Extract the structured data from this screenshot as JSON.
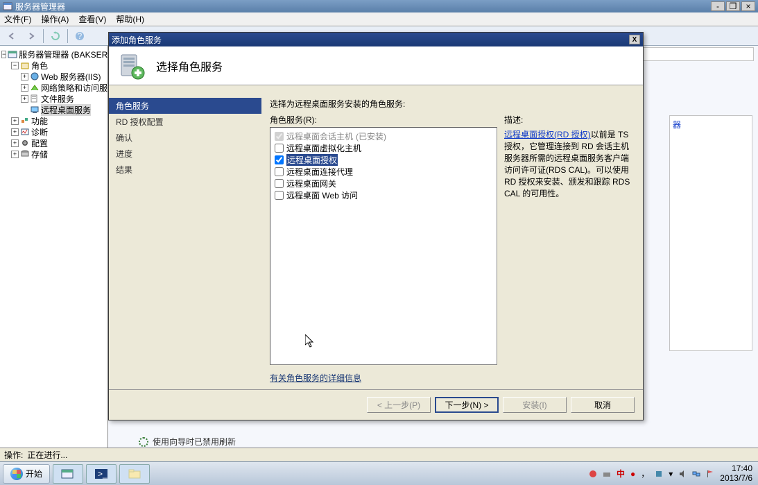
{
  "window": {
    "title": "服务器管理器",
    "minimize": "-",
    "restore": "❐",
    "close": "×"
  },
  "menu": {
    "file": "文件(F)",
    "action": "操作(A)",
    "view": "查看(V)",
    "help": "帮助(H)"
  },
  "tree": {
    "root": "服务器管理器 (BAKSERVEP",
    "roles": "角色",
    "iis": "Web 服务器(IIS)",
    "nap": "网络策略和访问服",
    "fileservices": "文件服务",
    "rds": "远程桌面服务",
    "features": "功能",
    "diagnostics": "诊断",
    "configuration": "配置",
    "storage": "存储"
  },
  "side": {
    "link": "器"
  },
  "wizard": {
    "title": "添加角色服务",
    "heading": "选择角色服务",
    "steps": {
      "s1": "角色服务",
      "s2": "RD 授权配置",
      "s3": "确认",
      "s4": "进度",
      "s5": "结果"
    },
    "instr": "选择为远程桌面服务安装的角色服务:",
    "listlabel": "角色服务(R):",
    "roles": {
      "r1": "远程桌面会话主机",
      "r1_installed": "(已安装)",
      "r2": "远程桌面虚拟化主机",
      "r3": "远程桌面授权",
      "r4": "远程桌面连接代理",
      "r5": "远程桌面网关",
      "r6": "远程桌面 Web 访问"
    },
    "desc_h": "描述:",
    "desc_link": "远程桌面授权(RD 授权)",
    "desc_body": "以前是 TS 授权，它管理连接到 RD 会话主机服务器所需的远程桌面服务客户端访问许可证(RDS CAL)。可以使用 RD 授权来安装、颁发和跟踪 RDS CAL 的可用性。",
    "helplink": "有关角色服务的详细信息",
    "btn_prev": "< 上一步(P)",
    "btn_next": "下一步(N) >",
    "btn_install": "安装(I)",
    "btn_cancel": "取消"
  },
  "refresh_status": "使用向导时已禁用刷新",
  "statusbar": {
    "label": "操作:",
    "value": "正在进行..."
  },
  "taskbar": {
    "start": "开始",
    "ime": "中",
    "time": "17:40",
    "date": "2013/7/6"
  }
}
